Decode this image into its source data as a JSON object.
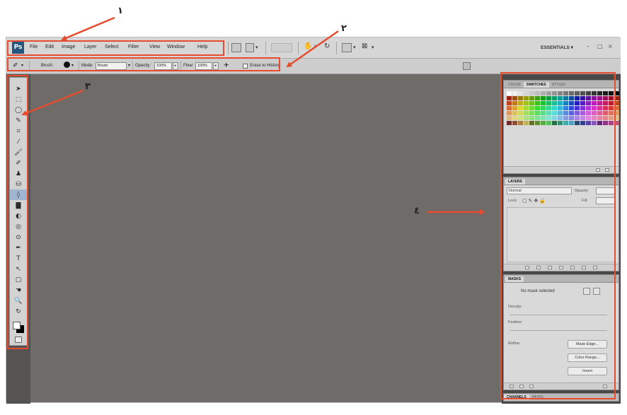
{
  "annotations": {
    "n1": "۱",
    "n2": "۲",
    "n3": "۳",
    "n4": "٤",
    "accent_color": "#e54d2e"
  },
  "menubar": {
    "logo": "Ps",
    "items": [
      "File",
      "Edit",
      "Image",
      "Layer",
      "Select",
      "Filter",
      "View",
      "Window",
      "Help"
    ],
    "workspace": "ESSENTIALS ▾",
    "window_controls": [
      "–",
      "□",
      "×"
    ]
  },
  "options": {
    "brush_label": "Brush:",
    "mode_label": "Mode:",
    "mode_value": "Brush",
    "opacity_label": "Opacity:",
    "opacity_value": "100%",
    "flow_label": "Flow:",
    "flow_value": "100%",
    "erase_history": "Erase to History"
  },
  "tools": [
    "➤",
    "⬚",
    "◯",
    "✎",
    "⌗",
    "⁄",
    "🖌",
    "✐",
    "♟",
    "⛁",
    "◊",
    "▇",
    "◐",
    "◎",
    "⊙",
    "✒",
    "T",
    "↖",
    "▢",
    "☚",
    "🔍",
    "↻"
  ],
  "panels": {
    "swatches": {
      "tabs": [
        "COLOR",
        "SWATCHES",
        "STYLES"
      ]
    },
    "layers": {
      "tabs": [
        "LAYERS"
      ],
      "blend_mode": "Normal",
      "opacity_label": "Opacity:",
      "lock_label": "Lock:",
      "fill_label": "Fill:"
    },
    "masks": {
      "tabs": [
        "MASKS"
      ],
      "status": "No mask selected",
      "density_label": "Density:",
      "feather_label": "Feather:",
      "refine_label": "Refine:",
      "buttons": [
        "Mask Edge...",
        "Color Range...",
        "Invert"
      ]
    },
    "bottom_tabs": [
      "CHANNELS",
      "PATHS"
    ]
  }
}
